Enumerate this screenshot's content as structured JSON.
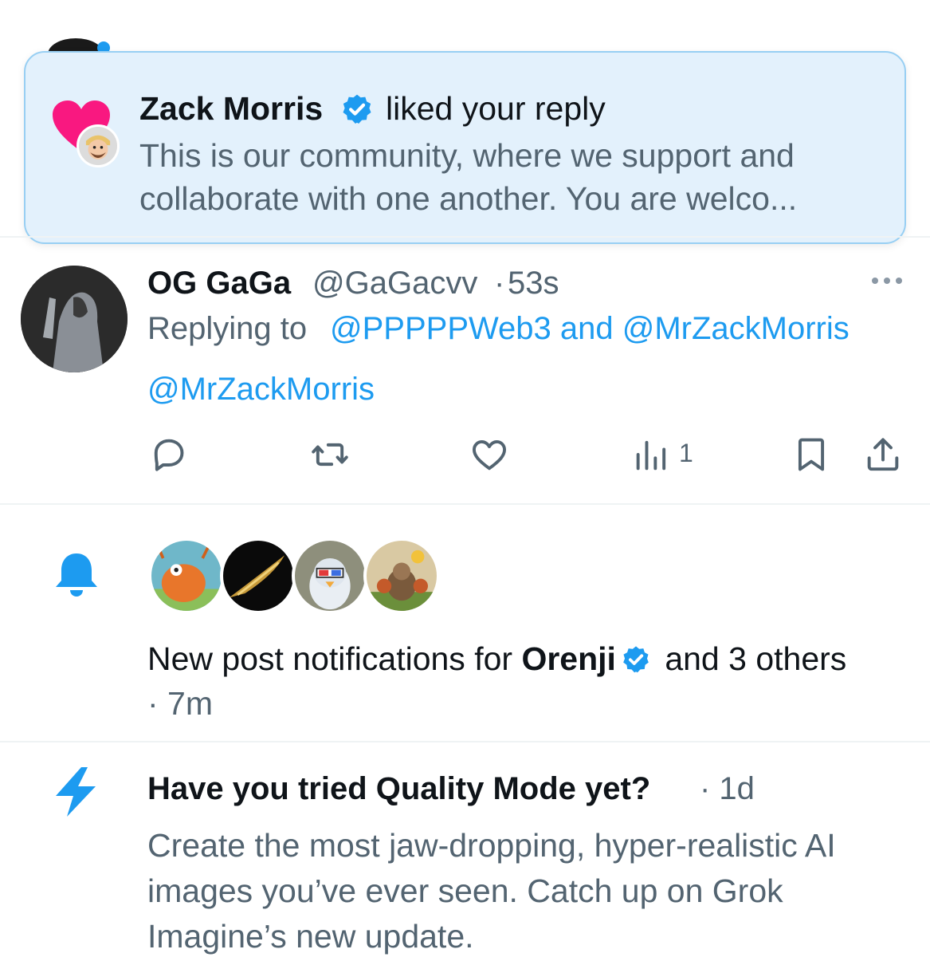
{
  "toast": {
    "user_name": "Zack Morris",
    "action": "liked your reply",
    "reply_preview": "This is our community, where we support and collaborate with one another. You are welco..."
  },
  "tweet": {
    "display_name": "OG GaGa",
    "handle": "@GaGacvv",
    "separator": "·",
    "time": "53s",
    "replying_label": "Replying to",
    "replying_users": "@PPPPPWeb3 and @MrZackMorris",
    "body_mention": "@MrZackMorris",
    "views": "1"
  },
  "notification": {
    "prefix": "New post notifications for ",
    "account": "Orenji",
    "suffix": " and 3 others",
    "time": "· 7m"
  },
  "promo": {
    "title": "Have you tried Quality Mode yet?",
    "meta": "· 1d",
    "body": "Create the most jaw-dropping, hyper-realistic AI images you’ve ever seen. Catch up on Grok Imagine’s new update."
  },
  "icons": {
    "toast": [
      "heart-icon",
      "verified-badge-icon"
    ],
    "tweet_actions": [
      "reply-icon",
      "repost-icon",
      "like-icon",
      "views-icon",
      "bookmark-icon",
      "share-icon"
    ],
    "notification": "bell-icon",
    "promo": "lightning-bolt-icon"
  },
  "colors": {
    "accent": "#1d9bf0",
    "heart": "#f91880",
    "text": "#0f1419",
    "muted": "#536471",
    "toast_bg": "#e3f1fc"
  }
}
